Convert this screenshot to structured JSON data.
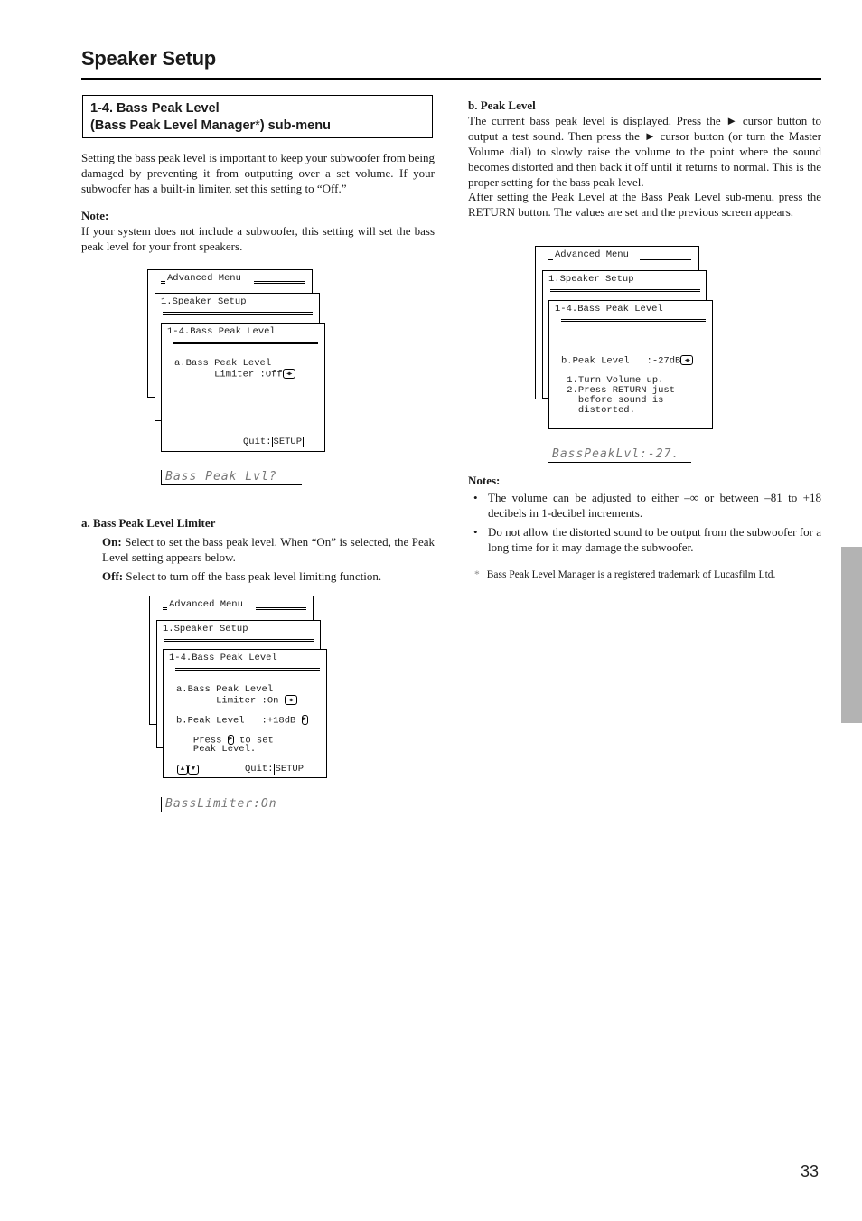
{
  "header": {
    "title": "Speaker Setup"
  },
  "section": {
    "heading_line1": "1-4.  Bass Peak Level",
    "heading_line2_pre": "(Bass Peak Level Manager",
    "heading_line2_ast": "*",
    "heading_line2_post": ") sub-menu",
    "intro": "Setting the bass peak level is important to keep your subwoofer from being damaged by preventing it from outputting over a set volume. If your subwoofer has a built-in limiter, set this setting to “Off.”",
    "note_label": "Note:",
    "note_text": "If your system does not include a subwoofer, this setting will set the bass peak level for your front speakers."
  },
  "screens": {
    "screen1": {
      "l1": "Advanced Menu",
      "l2": "1.Speaker Setup",
      "l3": "1-4.Bass Peak Level",
      "row_a1": "a.Bass Peak Level",
      "row_a2": "       Limiter :Off",
      "quit": "Quit:",
      "quit_key": "SETUP",
      "lcd": "Bass Peak Lvl?"
    },
    "screen2": {
      "l1": "Advanced Menu",
      "l2": "1.Speaker Setup",
      "l3": "1-4.Bass Peak Level",
      "row_a1": "a.Bass Peak Level",
      "row_a2": "       Limiter :On ",
      "row_b": "b.Peak Level   :+18dB ",
      "press1": "   Press ",
      "press2": " to set",
      "press3": "   Peak Level.",
      "quit": "Quit:",
      "quit_key": "SETUP",
      "lcd": "BassLimiter:On"
    },
    "screen3": {
      "l1": "Advanced Menu",
      "l2": "1.Speaker Setup",
      "l3": "1-4.Bass Peak Level",
      "row_b": "b.Peak Level   :-27dB",
      "step1": " 1.Turn Volume up.",
      "step2": " 2.Press RETURN just",
      "step3": "   before sound is",
      "step4": "   distorted.",
      "lcd": "BassPeakLvl:-27."
    }
  },
  "limiter": {
    "heading": "a. Bass Peak Level Limiter",
    "on_label": "On:",
    "on_text": " Select to set the bass peak level. When “On” is selected, the Peak Level setting appears below.",
    "off_label": "Off:",
    "off_text": " Select to turn off the bass peak level limiting function."
  },
  "peak": {
    "heading": "b. Peak Level",
    "para1": "The current bass peak level is displayed. Press the ► cursor button to output a test sound. Then press the ► cursor button (or turn the Master Volume dial) to slowly raise the volume to the point where the sound becomes distorted and then back it off until it returns to normal. This is the proper setting for the bass peak level.",
    "para2": "After setting the Peak Level at the Bass Peak Level sub-menu, press the RETURN button. The values are set and the previous screen appears."
  },
  "notes": {
    "label": "Notes:",
    "items": [
      "The volume can be adjusted to either –∞ or between –81 to +18 decibels in 1-decibel increments.",
      "Do not allow the distorted sound to be output from the subwoofer for a long time for it may damage the subwoofer."
    ],
    "footnote_mark": "*",
    "footnote": "Bass Peak Level Manager is a registered trademark of Lucasfilm Ltd."
  },
  "icons": {
    "left_right": "◀▶",
    "right": "▶",
    "up": "▲",
    "down": "▼"
  },
  "page_number": "33",
  "colors": {
    "side_tab": "#b3b3b3",
    "lcd_text": "#777777"
  }
}
